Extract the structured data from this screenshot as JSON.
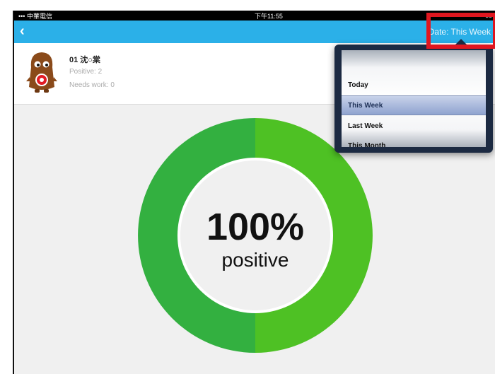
{
  "statusbar": {
    "carrier": "••• 中華電信",
    "time": "下午11:55"
  },
  "nav": {
    "back_icon": "chevron-left-icon",
    "date_label": "Date: This Week"
  },
  "profile": {
    "name": "01 沈○棠",
    "positive": "Positive: 2",
    "needs_work": "Needs work: 0"
  },
  "summary": {
    "percent": "100%",
    "label": "positive",
    "positive_fraction": 1.0
  },
  "date_picker": {
    "options": [
      "Today",
      "This Week",
      "Last Week",
      "This Month"
    ],
    "selected": "This Week"
  },
  "colors": {
    "nav": "#2bb0e8",
    "ring_dark": "#33b040",
    "ring_light": "#4ec124",
    "highlight": "#e0161f"
  }
}
